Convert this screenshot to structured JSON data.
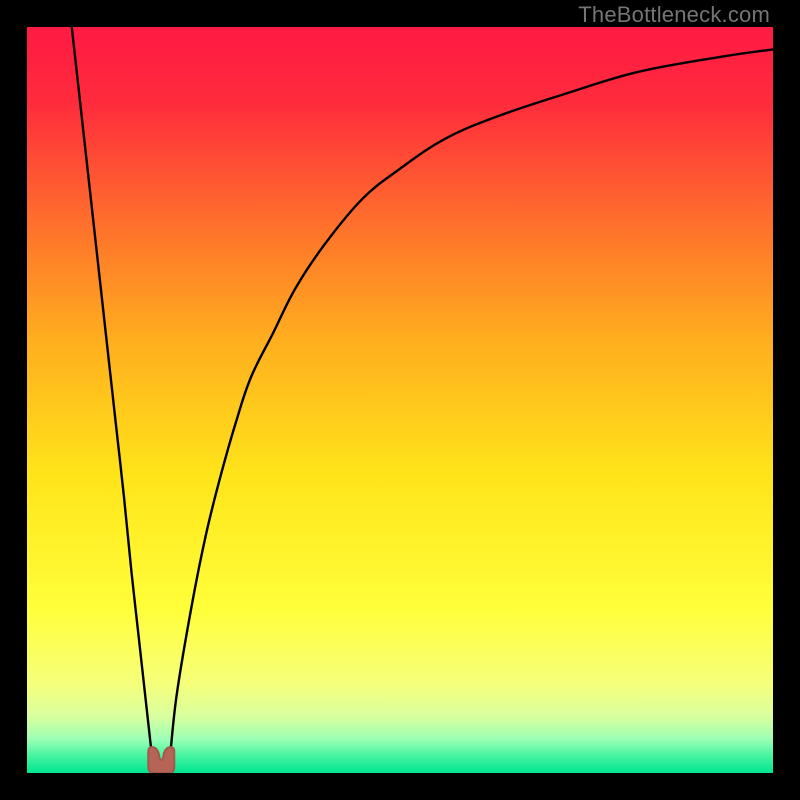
{
  "attribution": "TheBottleneck.com",
  "colors": {
    "frame_bg": "#000000",
    "gradient_stops": [
      {
        "offset": 0.0,
        "color": "#ff1a43"
      },
      {
        "offset": 0.1,
        "color": "#ff2b3c"
      },
      {
        "offset": 0.25,
        "color": "#ff6a2d"
      },
      {
        "offset": 0.42,
        "color": "#ffae1e"
      },
      {
        "offset": 0.6,
        "color": "#ffe41a"
      },
      {
        "offset": 0.78,
        "color": "#ffff3a"
      },
      {
        "offset": 0.88,
        "color": "#f6ff7a"
      },
      {
        "offset": 0.925,
        "color": "#d8ffa0"
      },
      {
        "offset": 0.955,
        "color": "#9bffb4"
      },
      {
        "offset": 0.975,
        "color": "#4cf5a3"
      },
      {
        "offset": 1.0,
        "color": "#00e58f"
      }
    ],
    "curve": "#000000",
    "marker_fill": "#b56455",
    "marker_stroke": "#a4584a"
  },
  "chart_data": {
    "type": "line",
    "title": "",
    "xlabel": "",
    "ylabel": "",
    "xlim": [
      0,
      100
    ],
    "ylim": [
      0,
      100
    ],
    "series": [
      {
        "name": "left_branch",
        "x": [
          6,
          7,
          8,
          9,
          10,
          11,
          12,
          13,
          14,
          15,
          16,
          17
        ],
        "values": [
          100,
          91,
          82,
          73,
          64,
          55,
          46,
          37,
          27,
          18,
          9,
          0
        ]
      },
      {
        "name": "right_branch",
        "x": [
          19,
          20,
          22,
          24,
          26,
          28,
          30,
          33,
          36,
          40,
          45,
          50,
          56,
          63,
          72,
          82,
          93,
          100
        ],
        "values": [
          0,
          10,
          22,
          32,
          40,
          47,
          53,
          59,
          65,
          71,
          77,
          81,
          85,
          88,
          91,
          94,
          96,
          97
        ]
      }
    ],
    "marker": {
      "x": 18,
      "y": 0
    },
    "notes": "x and y are percentages of the plot area; y is distance from the bottom (0 = green band, 100 = top)."
  }
}
